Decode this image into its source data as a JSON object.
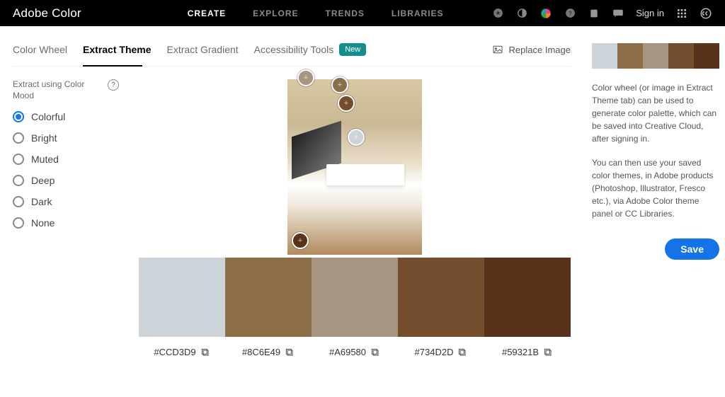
{
  "header": {
    "brand": "Adobe Color",
    "nav": [
      "CREATE",
      "EXPLORE",
      "TRENDS",
      "LIBRARIES"
    ],
    "active_nav": 0,
    "sign_in": "Sign in"
  },
  "subtabs": {
    "items": [
      "Color Wheel",
      "Extract Theme",
      "Extract Gradient",
      "Accessibility Tools"
    ],
    "active": 1,
    "new_badge": "New",
    "replace_image": "Replace Image"
  },
  "moods": {
    "title": "Extract using Color Mood",
    "items": [
      "Colorful",
      "Bright",
      "Muted",
      "Deep",
      "Dark",
      "None"
    ],
    "selected": 0
  },
  "palette": [
    {
      "hex": "#CCD3D9",
      "color": "#CCD3D9"
    },
    {
      "hex": "#8C6E49",
      "color": "#8C6E49"
    },
    {
      "hex": "#A69580",
      "color": "#A69580"
    },
    {
      "hex": "#734D2D",
      "color": "#734D2D"
    },
    {
      "hex": "#59321B",
      "color": "#59321B"
    }
  ],
  "side": {
    "para1": "Color wheel (or image in Extract Theme tab) can be used to generate color palette, which can be saved into Creative Cloud, after signing in.",
    "para2": "You can then use your saved color themes, in Adobe products (Photoshop, Illustrator, Fresco etc.), via Adobe Color theme panel or CC Libraries.",
    "save": "Save"
  }
}
